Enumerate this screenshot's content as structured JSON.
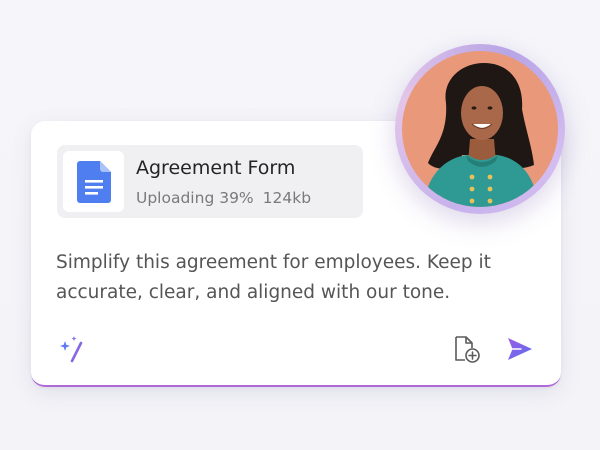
{
  "attachment": {
    "title": "Agreement Form",
    "progress_label": "Uploading 39%",
    "progress": 0.39,
    "size": "124kb",
    "icon": "google-doc-icon"
  },
  "prompt": {
    "text": "Simplify this agreement for employees. Keep it accurate, clear, and aligned with our tone."
  },
  "toolbar": {
    "left_icon": "magic-wand-sparkle-icon",
    "attach_icon": "add-file-icon",
    "send_icon": "send-icon"
  },
  "avatar": {
    "icon": "user-avatar-photo"
  },
  "colors": {
    "accent": "#8b5cf6",
    "send": "#7b61e0",
    "doc_blue": "#4f7ef0",
    "card_border": "#b06ad8",
    "avatar_bg": "#e9987a"
  }
}
